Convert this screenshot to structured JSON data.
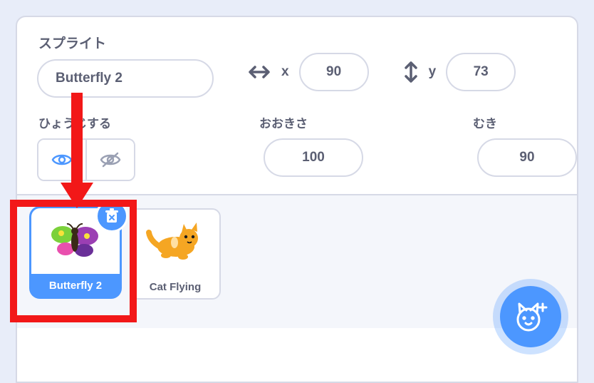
{
  "labels": {
    "sprite": "スプライト",
    "show": "ひょうじする",
    "size": "おおきさ",
    "direction": "むき",
    "x": "x",
    "y": "y"
  },
  "sprite_name": "Butterfly 2",
  "x": "90",
  "y": "73",
  "size": "100",
  "direction": "90",
  "sprites": [
    {
      "name": "Butterfly 2",
      "selected": true
    },
    {
      "name": "Cat Flying",
      "selected": false
    }
  ]
}
